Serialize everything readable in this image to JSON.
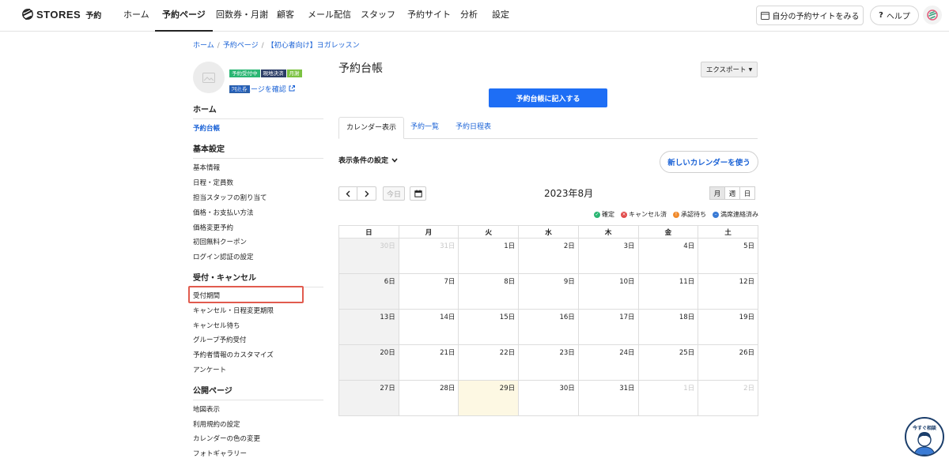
{
  "nav": {
    "brand": "STORES",
    "brand_sub": "予約",
    "items": [
      "ホーム",
      "予約ページ",
      "回数券・月謝",
      "顧客",
      "メール配信",
      "スタッフ",
      "予約サイト",
      "分析",
      "設定"
    ],
    "view_site": "自分の予約サイトをみる",
    "help": "ヘルプ"
  },
  "breadcrumb": [
    "ホーム",
    "予約ページ",
    "【初心者向け】ヨガレッスン"
  ],
  "badges": [
    {
      "label": "予約受付中",
      "color": "#2bb673"
    },
    {
      "label": "現地決済",
      "color": "#2c3e67"
    },
    {
      "label": "月謝",
      "color": "#7cc242"
    },
    {
      "label": "回数券",
      "color": "#2c5fa8"
    }
  ],
  "public_page_link": "公開ページを確認",
  "sidebar": {
    "sections": [
      {
        "title": "ホーム",
        "items": [
          "予約台帳"
        ]
      },
      {
        "title": "基本設定",
        "items": [
          "基本情報",
          "日程・定員数",
          "担当スタッフの割り当て",
          "価格・お支払い方法",
          "価格変更予約",
          "初回無料クーポン",
          "ログイン認証の設定"
        ]
      },
      {
        "title": "受付・キャンセル",
        "items": [
          "受付期間",
          "キャンセル・日程変更期限",
          "キャンセル待ち",
          "グループ予約受付",
          "予約者情報のカスタマイズ",
          "アンケート"
        ]
      },
      {
        "title": "公開ページ",
        "items": [
          "地図表示",
          "利用規約の設定",
          "カレンダーの色の変更",
          "フォトギャラリー"
        ]
      }
    ]
  },
  "main": {
    "title": "予約台帳",
    "export": "エクスポート",
    "primary_button": "予約台帳に記入する",
    "tabs": [
      "カレンダー表示",
      "予約一覧",
      "予約日程表"
    ],
    "conditions": "表示条件の設定",
    "new_calendar": "新しいカレンダーを使う"
  },
  "calendar": {
    "today_label": "今日",
    "month_title": "2023年8月",
    "views": [
      "月",
      "週",
      "日"
    ],
    "legend": [
      {
        "label": "確定",
        "color": "#2bb673",
        "symbol": "✓"
      },
      {
        "label": "キャンセル済",
        "color": "#e14b4b",
        "symbol": "×"
      },
      {
        "label": "承認待ち",
        "color": "#f08a2c",
        "symbol": "!"
      },
      {
        "label": "満席連絡済み",
        "color": "#3a7bd5",
        "symbol": "–"
      }
    ],
    "weekdays": [
      "日",
      "月",
      "火",
      "水",
      "木",
      "金",
      "土"
    ],
    "weeks": [
      [
        "30日",
        "31日",
        "1日",
        "2日",
        "3日",
        "4日",
        "5日"
      ],
      [
        "6日",
        "7日",
        "8日",
        "9日",
        "10日",
        "11日",
        "12日"
      ],
      [
        "13日",
        "14日",
        "15日",
        "16日",
        "17日",
        "18日",
        "19日"
      ],
      [
        "20日",
        "21日",
        "22日",
        "23日",
        "24日",
        "25日",
        "26日"
      ],
      [
        "27日",
        "28日",
        "29日",
        "30日",
        "31日",
        "1日",
        "2日"
      ]
    ]
  },
  "chat_widget": "今すぐ相談"
}
